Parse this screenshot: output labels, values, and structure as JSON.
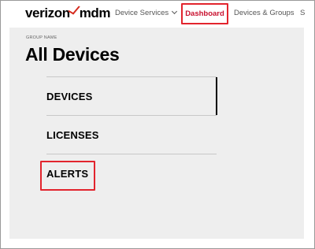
{
  "header": {
    "logo_word": "verizon",
    "logo_suffix": "mdm",
    "nav": {
      "device_services": "Device Services",
      "dashboard": "Dashboard",
      "devices_groups": "Devices & Groups",
      "overflow": "S"
    },
    "highlight_color": "#e2242d",
    "brand_color": "#d52b1e"
  },
  "group": {
    "label": "GROUP NAME",
    "title": "All Devices"
  },
  "menu": {
    "items": [
      {
        "label": "DEVICES"
      },
      {
        "label": "LICENSES"
      },
      {
        "label": "ALERTS"
      }
    ]
  }
}
